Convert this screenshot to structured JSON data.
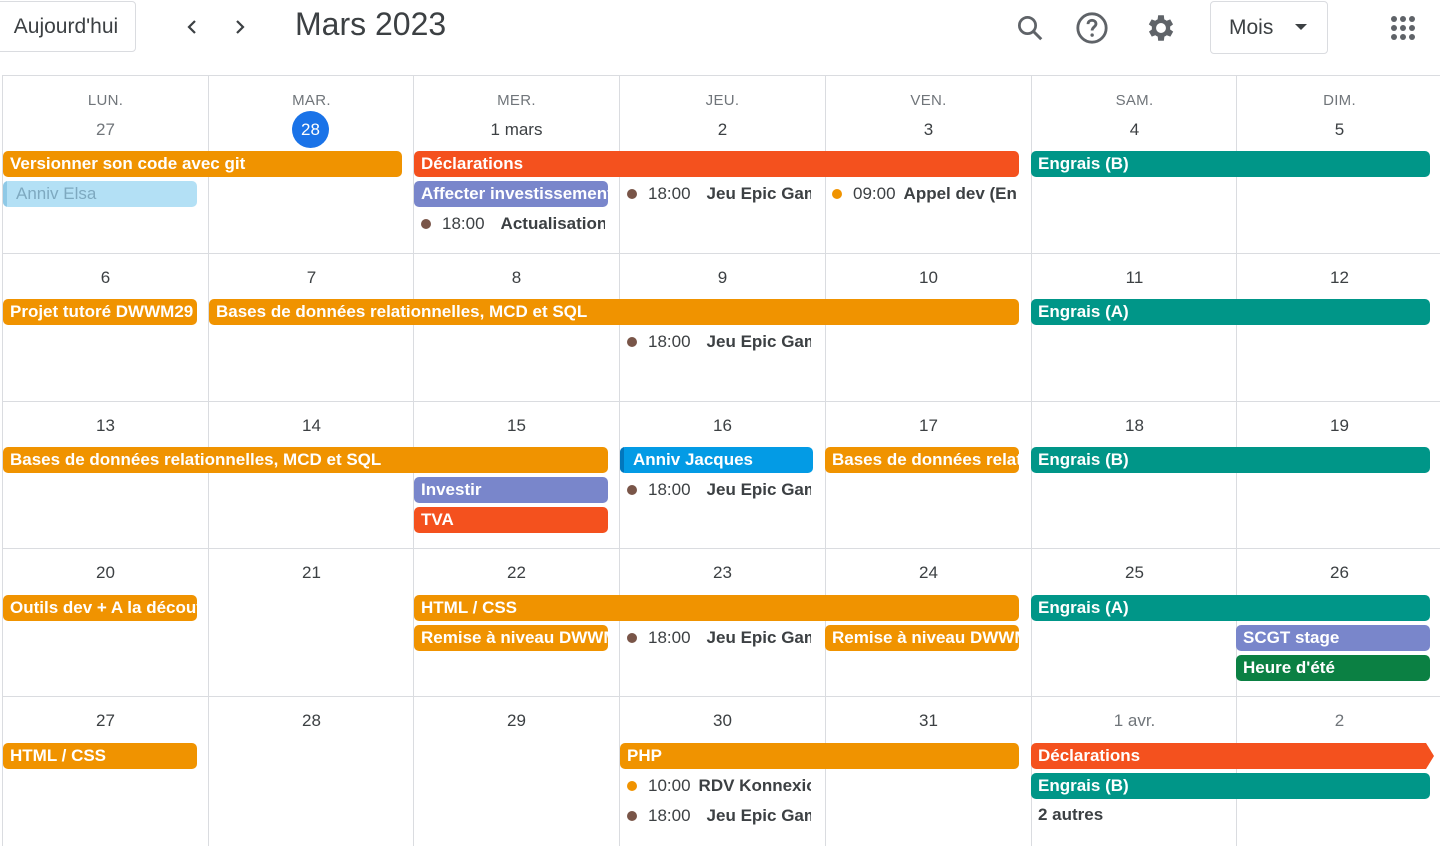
{
  "header": {
    "today_label": "Aujourd'hui",
    "month_title": "Mars 2023",
    "view_label": "Mois"
  },
  "colors": {
    "orange": "#f09300",
    "red": "#f4511e",
    "teal": "#009688",
    "lavender": "#7986cb",
    "blue": "#039be5",
    "lightblue": "#b3e0f5",
    "green": "#0b8043",
    "today": "#1a73e8",
    "dot_brown": "#795548"
  },
  "weekdays": [
    "LUN.",
    "MAR.",
    "MER.",
    "JEU.",
    "VEN.",
    "SAM.",
    "DIM."
  ],
  "weeks": [
    [
      "27",
      "28",
      "1 mars",
      "2",
      "3",
      "4",
      "5"
    ],
    [
      "6",
      "7",
      "8",
      "9",
      "10",
      "11",
      "12"
    ],
    [
      "13",
      "14",
      "15",
      "16",
      "17",
      "18",
      "19"
    ],
    [
      "20",
      "21",
      "22",
      "23",
      "24",
      "25",
      "26"
    ],
    [
      "27",
      "28",
      "29",
      "30",
      "31",
      "1 avr.",
      "2"
    ]
  ],
  "events": {
    "w1_git": "Versionner son code avec git",
    "w1_anniv_elsa": "Anniv Elsa",
    "w1_declarations": "Déclarations",
    "w1_engrais": "Engrais (B)",
    "w1_invest": "Affecter investissement",
    "w1_act_time": "18:00",
    "w1_act_title": "Actualisation",
    "w1_epic_time": "18:00",
    "w1_epic_title": "Jeu Epic Games",
    "w1_appel_time": "09:00",
    "w1_appel_title": "Appel dev (En",
    "w2_projet": "Projet tutoré DWWM29",
    "w2_bdd": "Bases de données relationnelles, MCD et SQL",
    "w2_engrais": "Engrais (A)",
    "w2_epic_time": "18:00",
    "w2_epic_title": "Jeu Epic Games",
    "w3_bdd": "Bases de données relationnelles, MCD et SQL",
    "w3_anniv_jacques": "Anniv Jacques",
    "w3_bdd2": "Bases de données relationnelles",
    "w3_engrais": "Engrais (B)",
    "w3_investir": "Investir",
    "w3_tva": "TVA",
    "w3_epic_time": "18:00",
    "w3_epic_title": "Jeu Epic Games",
    "w4_outils": "Outils dev + A la découverte",
    "w4_html": "HTML / CSS",
    "w4_engrais": "Engrais (A)",
    "w4_remise1": "Remise à niveau DWWM",
    "w4_remise2": "Remise à niveau DWWM",
    "w4_scgt": "SCGT stage",
    "w4_heure": "Heure d'été",
    "w4_epic_time": "18:00",
    "w4_epic_title": "Jeu Epic Games",
    "w5_html": "HTML / CSS",
    "w5_php": "PHP",
    "w5_declarations": "Déclarations",
    "w5_engrais": "Engrais (B)",
    "w5_more": "2 autres",
    "w5_rdv_time": "10:00",
    "w5_rdv_title": "RDV Konnexion",
    "w5_epic_time": "18:00",
    "w5_epic_title": "Jeu Epic Games"
  }
}
